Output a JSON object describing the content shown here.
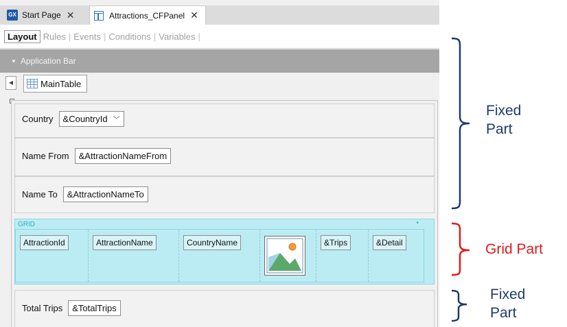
{
  "tabs": {
    "start_page": {
      "icon_text": "GX",
      "label": "Start Page",
      "close": "✕"
    },
    "panel": {
      "label": "Attractions_CFPanel",
      "close": "✕"
    }
  },
  "subtabs": [
    "Layout",
    "Rules",
    "Events",
    "Conditions",
    "Variables"
  ],
  "application_bar": {
    "label": "Application Bar"
  },
  "main_table": {
    "label": "MainTable"
  },
  "form": {
    "country": {
      "label": "Country",
      "value": "&CountryId"
    },
    "name_from": {
      "label": "Name From",
      "value": "&AttractionNameFrom"
    },
    "name_to": {
      "label": "Name To",
      "value": "&AttractionNameTo"
    },
    "total_trips": {
      "label": "Total Trips",
      "value": "&TotalTrips"
    }
  },
  "grid": {
    "title": "GRID",
    "indicator": "•",
    "columns": [
      "AttractionId",
      "AttractionName",
      "CountryName",
      "",
      "&Trips",
      "&Detail"
    ]
  },
  "annotations": {
    "fixed_top": [
      "Fixed",
      "Part"
    ],
    "grid_part": "Grid Part",
    "fixed_bottom": [
      "Fixed",
      "Part"
    ]
  },
  "colors": {
    "annotation_navy": "#1f3a6e",
    "annotation_red": "#e01b1b",
    "grid_fill": "#bcecf3",
    "app_bar": "#a5a5a5"
  }
}
